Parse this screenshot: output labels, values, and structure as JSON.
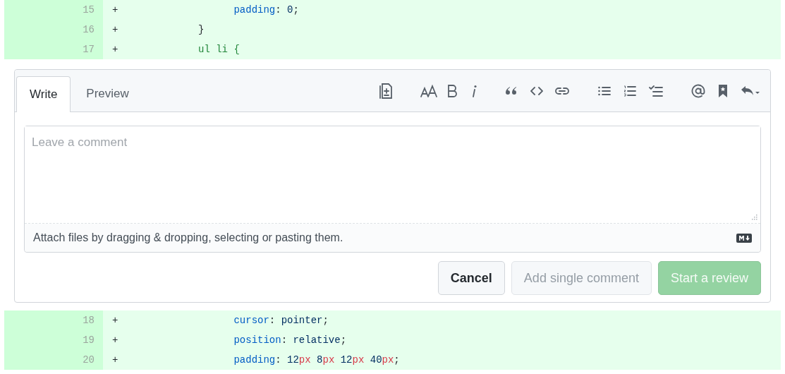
{
  "diff_top": [
    {
      "number": "15",
      "sign": "+",
      "tokens": [
        {
          "text": "                padding",
          "kind": "prop"
        },
        {
          "text": ": ",
          "kind": "punct"
        },
        {
          "text": "0",
          "kind": "value"
        },
        {
          "text": ";",
          "kind": "punct"
        }
      ]
    },
    {
      "number": "16",
      "sign": "+",
      "tokens": [
        {
          "text": "          }",
          "kind": "punct"
        }
      ]
    },
    {
      "number": "17",
      "sign": "+",
      "tokens": [
        {
          "text": "          ul li {",
          "kind": "selector"
        }
      ]
    }
  ],
  "comment_form": {
    "tabs": [
      {
        "label": "Write",
        "selected": true
      },
      {
        "label": "Preview",
        "selected": false
      }
    ],
    "toolbar": [
      {
        "kind": "template"
      },
      {
        "kind": "heading"
      },
      {
        "kind": "bold"
      },
      {
        "kind": "italic"
      },
      {
        "kind": "quote"
      },
      {
        "kind": "code"
      },
      {
        "kind": "link"
      },
      {
        "kind": "bullets"
      },
      {
        "kind": "numbers"
      },
      {
        "kind": "tasks"
      },
      {
        "kind": "mention"
      },
      {
        "kind": "bookmark"
      },
      {
        "kind": "reply"
      }
    ],
    "comment": {
      "placeholder": "Leave a comment"
    },
    "attach_hint": "Attach files by dragging & dropping, selecting or pasting them.",
    "buttons": [
      {
        "label": "Cancel",
        "kind": "default",
        "disabled": false
      },
      {
        "label": "Add single comment",
        "kind": "default",
        "disabled": true
      },
      {
        "label": "Start a review",
        "kind": "primary",
        "disabled": true
      }
    ]
  },
  "diff_bottom": [
    {
      "number": "18",
      "sign": "+",
      "tokens": [
        {
          "text": "                cursor",
          "kind": "prop"
        },
        {
          "text": ": ",
          "kind": "punct"
        },
        {
          "text": "pointer",
          "kind": "value"
        },
        {
          "text": ";",
          "kind": "punct"
        }
      ]
    },
    {
      "number": "19",
      "sign": "+",
      "tokens": [
        {
          "text": "                position",
          "kind": "prop"
        },
        {
          "text": ": ",
          "kind": "punct"
        },
        {
          "text": "relative",
          "kind": "value"
        },
        {
          "text": ";",
          "kind": "punct"
        }
      ]
    },
    {
      "number": "20",
      "sign": "+",
      "tokens": [
        {
          "text": "                padding",
          "kind": "prop"
        },
        {
          "text": ": ",
          "kind": "punct"
        },
        {
          "text": "12",
          "kind": "value"
        },
        {
          "text": "px ",
          "kind": "unit"
        },
        {
          "text": "8",
          "kind": "value"
        },
        {
          "text": "px ",
          "kind": "unit"
        },
        {
          "text": "12",
          "kind": "value"
        },
        {
          "text": "px ",
          "kind": "unit"
        },
        {
          "text": "40",
          "kind": "value"
        },
        {
          "text": "px",
          "kind": "unit"
        },
        {
          "text": ";",
          "kind": "punct"
        }
      ]
    }
  ]
}
